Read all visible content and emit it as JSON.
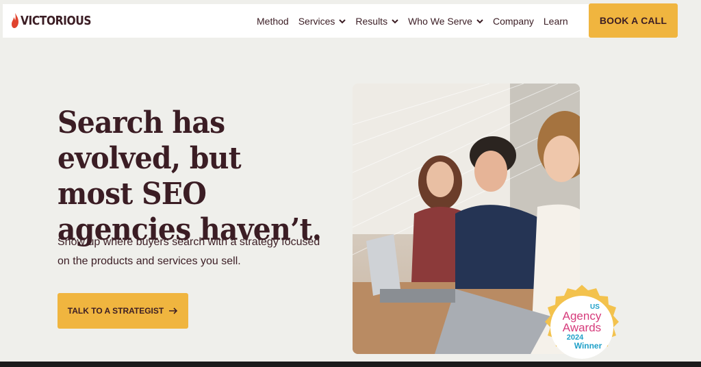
{
  "header": {
    "logo_text": "VICTORIOUS",
    "nav": [
      {
        "label": "Method",
        "has_dropdown": false
      },
      {
        "label": "Services",
        "has_dropdown": true
      },
      {
        "label": "Results",
        "has_dropdown": true
      },
      {
        "label": "Who We Serve",
        "has_dropdown": true
      },
      {
        "label": "Company",
        "has_dropdown": false
      },
      {
        "label": "Learn",
        "has_dropdown": false
      }
    ],
    "cta_label": "BOOK A CALL"
  },
  "hero": {
    "headline": "Search has evolved, but most SEO agencies haven’t.",
    "subhead": "Show up where buyers search with a strategy focused on the products and services you sell.",
    "cta_label": "TALK TO A STRATEGIST"
  },
  "badge": {
    "us": "US",
    "line1": "Agency",
    "line2": "Awards",
    "year": "2024",
    "winner": "Winner"
  },
  "colors": {
    "background": "#efefeb",
    "accent": "#f0b53f",
    "text": "#3b1d24",
    "brand_red": "#e0432e"
  },
  "icons": [
    "flame-logo-icon",
    "chevron-down-icon",
    "arrow-right-icon"
  ]
}
